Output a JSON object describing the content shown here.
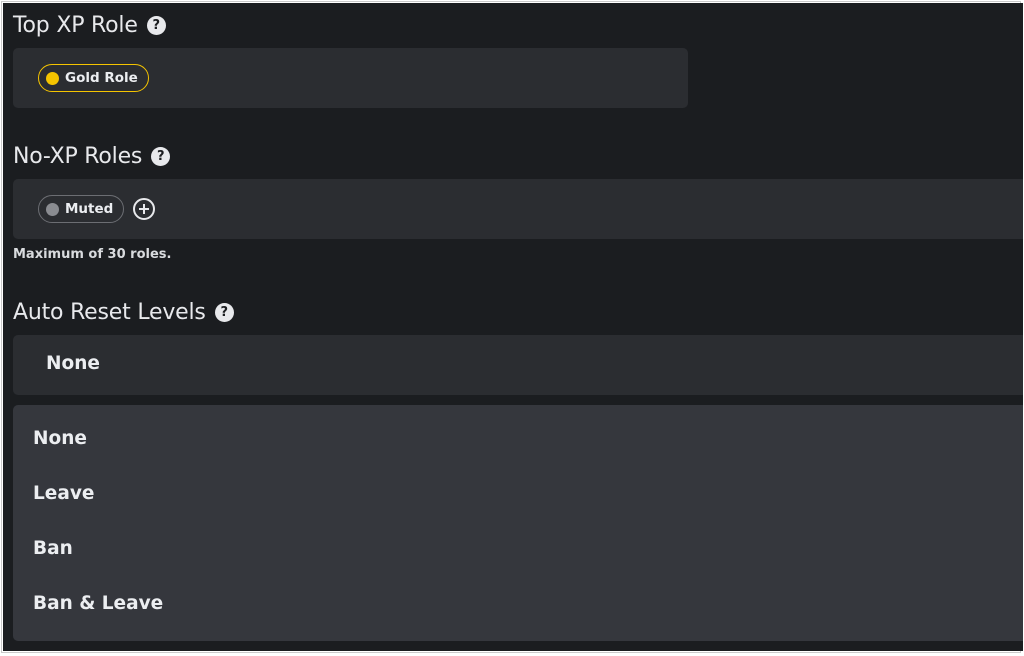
{
  "top_xp_role": {
    "title": "Top XP Role",
    "help_icon": "help-icon",
    "role": {
      "label": "Gold Role",
      "color": "#f5c400"
    }
  },
  "no_xp_roles": {
    "title": "No-XP Roles",
    "help_icon": "help-icon",
    "roles": [
      {
        "label": "Muted",
        "color": "#8a8c91"
      }
    ],
    "add_icon": "plus-circle-icon",
    "hint": "Maximum of 30 roles."
  },
  "auto_reset": {
    "title": "Auto Reset Levels",
    "help_icon": "help-icon",
    "selected": "None",
    "options": [
      "None",
      "Leave",
      "Ban",
      "Ban & Leave"
    ]
  },
  "colors": {
    "background": "#1b1d20",
    "panel": "#2b2d31",
    "dropdown": "#35373d",
    "gold_accent": "#f5c400"
  }
}
